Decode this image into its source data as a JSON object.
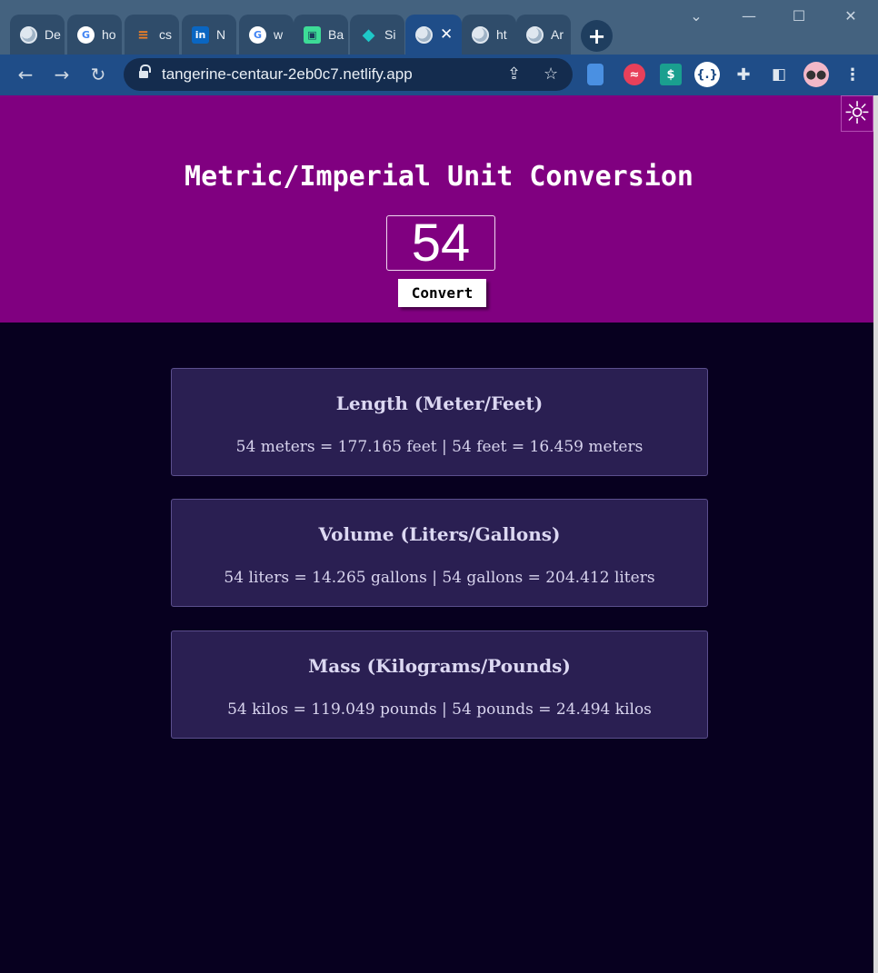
{
  "browser": {
    "tabs": [
      {
        "title": "De",
        "icon": "globe-icon"
      },
      {
        "title": "ho",
        "icon": "google-icon"
      },
      {
        "title": "cs",
        "icon": "stackoverflow-icon"
      },
      {
        "title": "N",
        "icon": "linkedin-icon"
      },
      {
        "title": "w",
        "icon": "google-icon"
      },
      {
        "title": "Ba",
        "icon": "app-icon"
      },
      {
        "title": "Si",
        "icon": "diamond-icon"
      },
      {
        "title": "",
        "icon": "globe-icon",
        "active": true
      },
      {
        "title": "ht",
        "icon": "globe-icon"
      },
      {
        "title": "Ar",
        "icon": "globe-icon"
      }
    ],
    "url": "tangerine-centaur-2eb0c7.netlify.app"
  },
  "app": {
    "title": "Metric/Imperial Unit Conversion",
    "input_value": "54",
    "convert_label": "Convert",
    "colors": {
      "hero": "#800080",
      "background": "#07001f",
      "card": "#2a1f52"
    }
  },
  "cards": [
    {
      "title": "Length (Meter/Feet)",
      "result": "54 meters = 177.165 feet | 54 feet = 16.459 meters"
    },
    {
      "title": "Volume (Liters/Gallons)",
      "result": "54 liters = 14.265 gallons | 54 gallons = 204.412 liters"
    },
    {
      "title": "Mass (Kilograms/Pounds)",
      "result": "54 kilos = 119.049 pounds | 54 pounds = 24.494 kilos"
    }
  ]
}
